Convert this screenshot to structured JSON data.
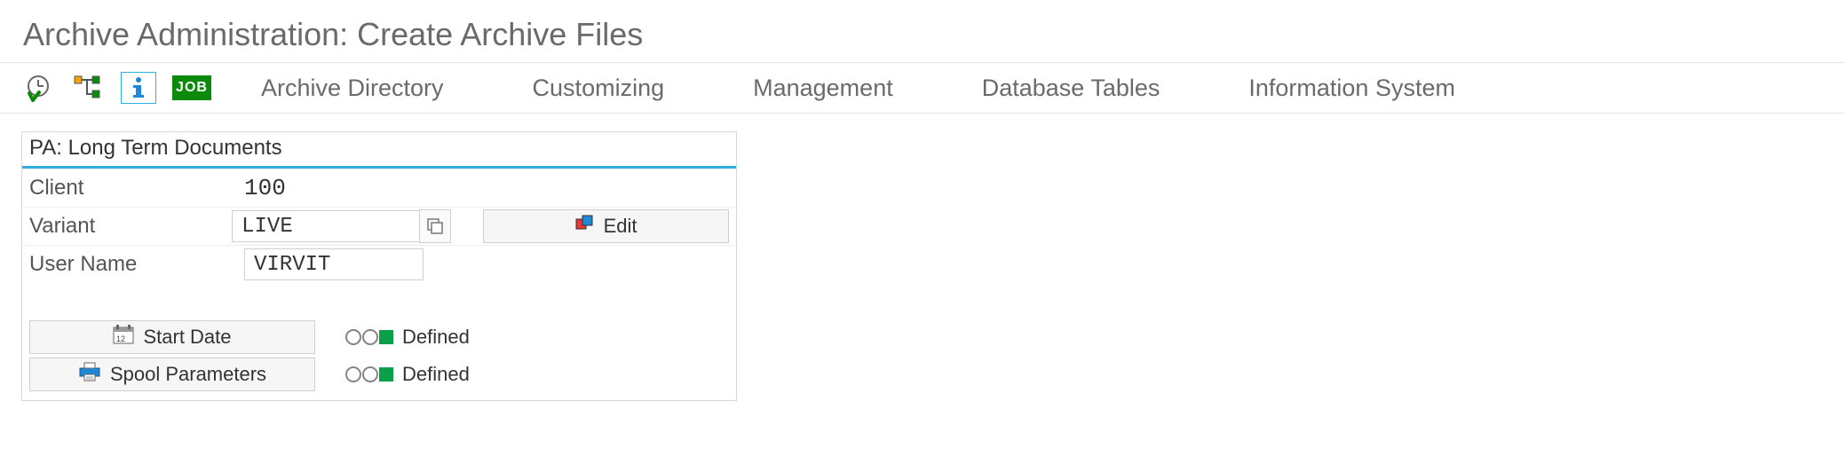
{
  "title": "Archive Administration: Create Archive Files",
  "toolbar": {
    "links": {
      "archive_directory": "Archive Directory",
      "customizing": "Customizing",
      "management": "Management",
      "database_tables": "Database Tables",
      "information_system": "Information System"
    }
  },
  "panel": {
    "title": "PA: Long Term Documents",
    "labels": {
      "client": "Client",
      "variant": "Variant",
      "user_name": "User Name"
    },
    "values": {
      "client": "100",
      "variant": "LIVE",
      "user_name": "VIRVIT"
    },
    "buttons": {
      "edit": "Edit",
      "start_date": "Start Date",
      "spool_parameters": "Spool Parameters"
    },
    "status": {
      "start_date": "Defined",
      "spool_parameters": "Defined"
    }
  },
  "icons": {
    "execute": "execute-clock-icon",
    "hierarchy": "hierarchy-icon",
    "info": "info-icon",
    "job": "JOB"
  },
  "colors": {
    "accent": "#2fb0e0",
    "green": "#0aa04a",
    "job_bg": "#0b8a0b"
  }
}
